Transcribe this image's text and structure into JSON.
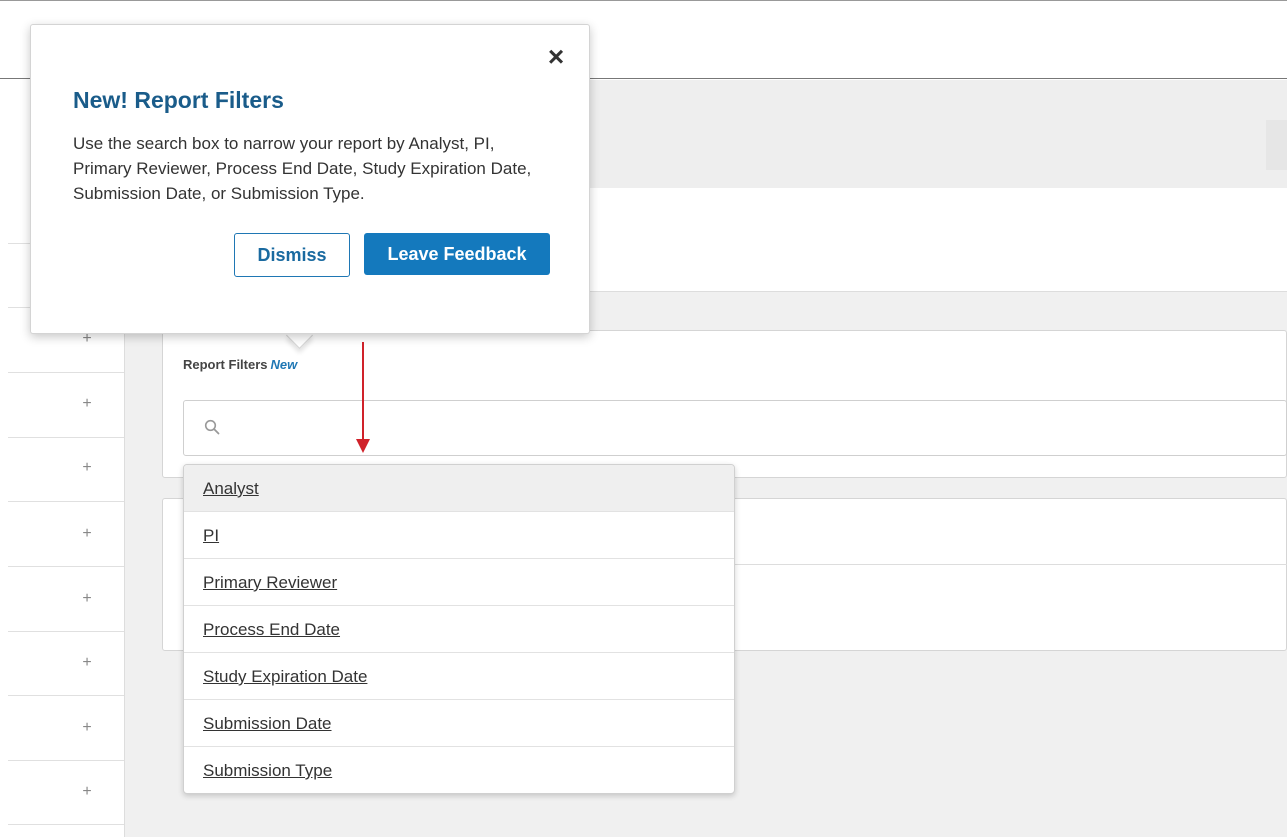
{
  "popover": {
    "title": "New! Report Filters",
    "body": "Use the search box to narrow your report by Analyst, PI, Primary Reviewer, Process End Date, Study Expiration Date, Submission Date, or Submission Type.",
    "close_icon": "close-icon",
    "dismiss_label": "Dismiss",
    "feedback_label": "Leave Feedback"
  },
  "filters": {
    "label": "Report Filters",
    "badge": "New",
    "search_placeholder": "",
    "search_icon": "search-icon"
  },
  "dropdown": {
    "options": [
      "Analyst",
      "PI",
      "Primary Reviewer",
      "Process End Date",
      "Study Expiration Date",
      "Submission Date",
      "Submission Type"
    ]
  },
  "sidebar": {
    "plus_symbol": "+"
  },
  "colors": {
    "accent": "#1479bd",
    "title": "#1a5c8a",
    "annotation_arrow": "#d0222a"
  }
}
